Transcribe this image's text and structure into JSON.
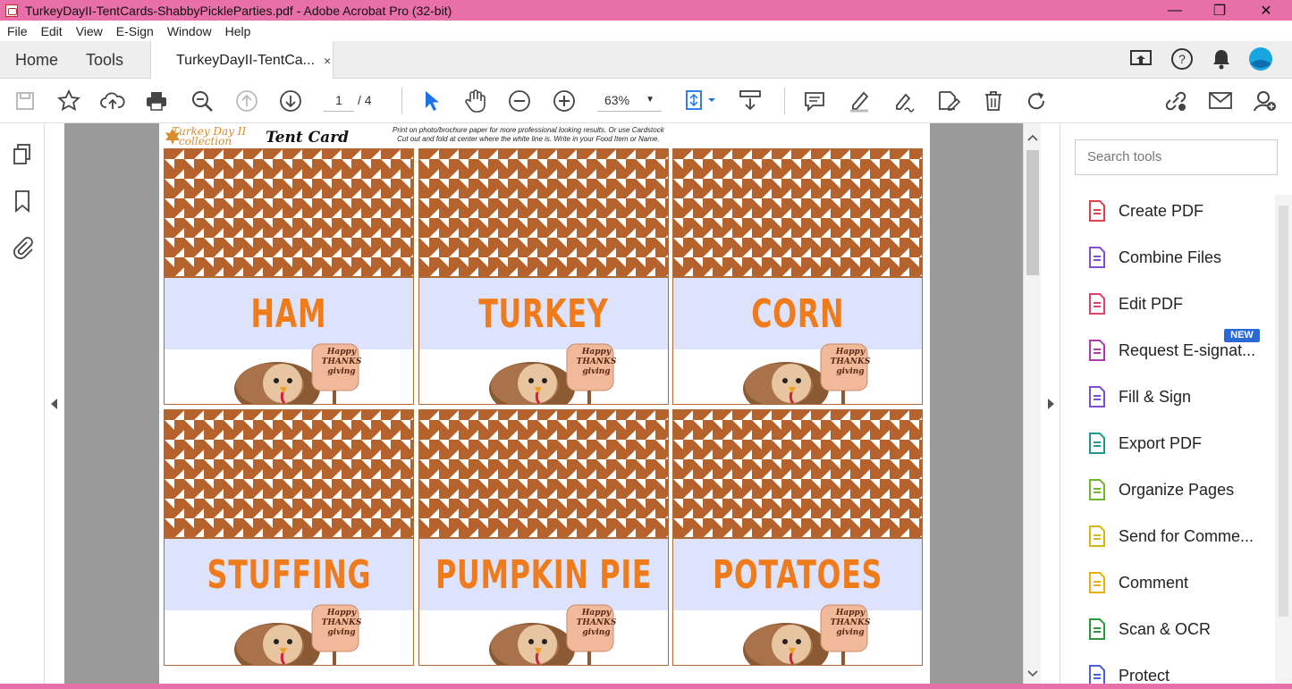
{
  "window": {
    "title": "TurkeyDayII-TentCards-ShabbyPickleParties.pdf - Adobe Acrobat Pro (32-bit)",
    "minimize": "—",
    "restore": "❐",
    "close": "✕"
  },
  "menu": [
    "File",
    "Edit",
    "View",
    "E-Sign",
    "Window",
    "Help"
  ],
  "tabs": {
    "home": "Home",
    "tools": "Tools",
    "document": "TurkeyDayII-TentCa...",
    "close": "×"
  },
  "toolbar": {
    "page_current": "1",
    "page_total": "/ 4",
    "zoom": "63%"
  },
  "document": {
    "header_logo_line1": "Turkey Day II",
    "header_logo_line2": "collection",
    "header_title": "Tent Card",
    "header_note_line1": "Print on photo/brochure paper for more professional looking results. Or use Cardstock",
    "header_note_line2": "Cut out and fold at center where the white line is. Write in your Food Item or Name.",
    "cards": [
      {
        "label": "HAM"
      },
      {
        "label": "TURKEY"
      },
      {
        "label": "CORN"
      },
      {
        "label": "STUFFING"
      },
      {
        "label": "PUMPKIN PIE"
      },
      {
        "label": "POTATOES"
      }
    ],
    "sign_text": [
      "Happy",
      "THANKS",
      "giving"
    ],
    "colors": {
      "pattern": "#b5622c",
      "band": "#dde3fd",
      "label": "#f07b1a"
    }
  },
  "right_panel": {
    "search_placeholder": "Search tools",
    "new_badge": "NEW",
    "tools": [
      {
        "label": "Create PDF",
        "icon": "create-pdf-icon",
        "color": "#e0414b"
      },
      {
        "label": "Combine Files",
        "icon": "combine-files-icon",
        "color": "#7b4fd8"
      },
      {
        "label": "Edit PDF",
        "icon": "edit-pdf-icon",
        "color": "#e0416b"
      },
      {
        "label": "Request E-signat...",
        "icon": "request-esign-icon",
        "color": "#b03aa8"
      },
      {
        "label": "Fill & Sign",
        "icon": "fill-sign-icon",
        "color": "#7a4fd0"
      },
      {
        "label": "Export PDF",
        "icon": "export-pdf-icon",
        "color": "#1d9a8a"
      },
      {
        "label": "Organize Pages",
        "icon": "organize-pages-icon",
        "color": "#6cba2a"
      },
      {
        "label": "Send for Comme...",
        "icon": "send-for-comment-icon",
        "color": "#d6b60f"
      },
      {
        "label": "Comment",
        "icon": "comment-icon",
        "color": "#e8b10a"
      },
      {
        "label": "Scan & OCR",
        "icon": "scan-ocr-icon",
        "color": "#2c9a3a"
      },
      {
        "label": "Protect",
        "icon": "protect-icon",
        "color": "#4b5fd6"
      }
    ]
  }
}
